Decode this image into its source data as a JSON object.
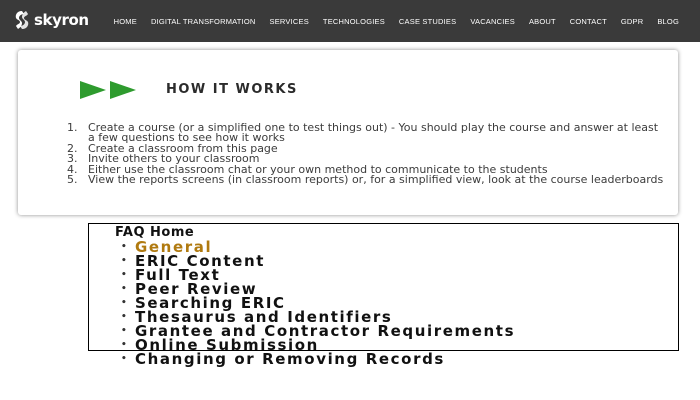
{
  "brand": {
    "name": "skyron"
  },
  "nav": {
    "items": [
      "HOME",
      "DIGITAL TRANSFORMATION",
      "SERVICES",
      "TECHNOLOGIES",
      "CASE STUDIES",
      "VACANCIES",
      "ABOUT",
      "CONTACT",
      "GDPR",
      "BLOG"
    ]
  },
  "how_it_works": {
    "title": "HOW IT WORKS",
    "accent_color": "#2e9b2e",
    "steps": [
      "Create a course (or a simplified one to test things out) - You should play the course and answer at least a few questions to see how it works",
      "Create a classroom from this page",
      "Invite others to your classroom",
      "Either use the classroom chat or your own method to communicate to the students",
      "View the reports screens (in classroom reports) or, for a simplified view, look at the course leaderboards"
    ]
  },
  "faq": {
    "heading": "FAQ Home",
    "active_color": "#b07a10",
    "items": [
      "General",
      "ERIC Content",
      "Full Text",
      "Peer Review",
      "Searching ERIC",
      "Thesaurus and Identifiers",
      "Grantee and Contractor Requirements",
      "Online Submission",
      "Changing or Removing Records"
    ]
  }
}
